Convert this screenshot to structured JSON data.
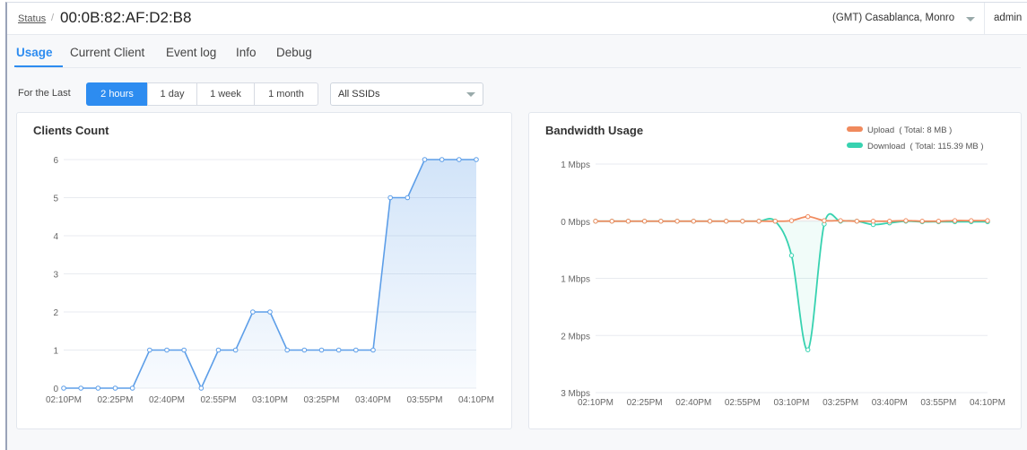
{
  "header": {
    "breadcrumb_link": "Status",
    "breadcrumb_sep": "/",
    "title": "00:0B:82:AF:D2:B8",
    "timezone": "(GMT) Casablanca, Monro",
    "user": "admin"
  },
  "tabs": [
    {
      "label": "Usage",
      "active": true
    },
    {
      "label": "Current Client",
      "active": false
    },
    {
      "label": "Event log",
      "active": false
    },
    {
      "label": "Info",
      "active": false
    },
    {
      "label": "Debug",
      "active": false
    }
  ],
  "filter": {
    "label": "For the Last",
    "ranges": [
      {
        "label": "2 hours",
        "active": true
      },
      {
        "label": "1 day",
        "active": false
      },
      {
        "label": "1 week",
        "active": false
      },
      {
        "label": "1 month",
        "active": false
      }
    ],
    "ssid_selected": "All SSIDs"
  },
  "colors": {
    "accent": "#2d8cf0",
    "clients_line": "#5d9ee8",
    "upload": "#f08a5d",
    "download": "#37d2b0"
  },
  "chart_data": [
    {
      "type": "area",
      "title": "Clients Count",
      "x": [
        "02:10PM",
        "02:15PM",
        "02:20PM",
        "02:25PM",
        "02:30PM",
        "02:35PM",
        "02:40PM",
        "02:45PM",
        "02:50PM",
        "02:55PM",
        "03:00PM",
        "03:05PM",
        "03:10PM",
        "03:15PM",
        "03:20PM",
        "03:25PM",
        "03:30PM",
        "03:35PM",
        "03:40PM",
        "03:45PM",
        "03:50PM",
        "03:55PM",
        "04:00PM",
        "04:05PM",
        "04:10PM"
      ],
      "x_tick_labels": [
        "02:10PM",
        "02:25PM",
        "02:40PM",
        "02:55PM",
        "03:10PM",
        "03:25PM",
        "03:40PM",
        "03:55PM",
        "04:10PM"
      ],
      "y_tick_labels": [
        "0",
        "1",
        "2",
        "3",
        "4",
        "5",
        "6"
      ],
      "ylim": [
        0,
        6
      ],
      "series": [
        {
          "values": [
            0,
            0,
            0,
            0,
            0,
            1,
            1,
            1,
            0,
            1,
            1,
            2,
            2,
            1,
            1,
            1,
            1,
            1,
            1,
            5,
            5,
            6,
            6,
            6,
            6
          ]
        }
      ],
      "grid": true
    },
    {
      "type": "line",
      "title": "Bandwidth Usage",
      "x": [
        "02:10PM",
        "02:15PM",
        "02:20PM",
        "02:25PM",
        "02:30PM",
        "02:35PM",
        "02:40PM",
        "02:45PM",
        "02:50PM",
        "02:55PM",
        "03:00PM",
        "03:05PM",
        "03:10PM",
        "03:15PM",
        "03:20PM",
        "03:25PM",
        "03:30PM",
        "03:35PM",
        "03:40PM",
        "03:45PM",
        "03:50PM",
        "03:55PM",
        "04:00PM",
        "04:05PM",
        "04:10PM"
      ],
      "x_tick_labels": [
        "02:10PM",
        "02:25PM",
        "02:40PM",
        "02:55PM",
        "03:10PM",
        "03:25PM",
        "03:40PM",
        "03:55PM",
        "04:10PM"
      ],
      "y_tick_labels": [
        "1 Mbps",
        "0 Mbps",
        "1 Mbps",
        "2 Mbps",
        "3 Mbps"
      ],
      "ylim": [
        -3,
        1
      ],
      "legend_position": "top-right",
      "series": [
        {
          "name": "Upload",
          "total": "( Total: 8 MB )",
          "values": [
            0,
            0,
            0,
            0,
            0,
            0,
            0,
            0,
            0,
            0,
            0,
            0,
            0.01,
            0.08,
            0.01,
            0.01,
            0,
            0,
            0,
            0.01,
            0,
            0,
            0.01,
            0.01,
            0.01
          ]
        },
        {
          "name": "Download",
          "total": "( Total: 115.39 MB )",
          "values": [
            0,
            0,
            0,
            0,
            0,
            0,
            0,
            0,
            0,
            0,
            0,
            0,
            -0.6,
            -2.25,
            -0.05,
            0,
            0,
            -0.06,
            -0.03,
            0,
            -0.01,
            -0.01,
            -0.01,
            -0.01,
            -0.01
          ]
        }
      ],
      "grid": true
    }
  ]
}
